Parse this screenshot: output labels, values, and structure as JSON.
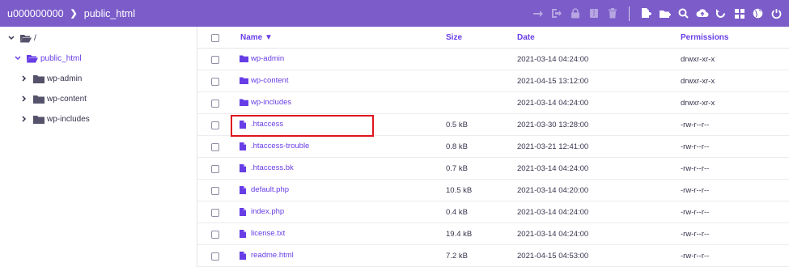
{
  "header": {
    "user": "u000000000",
    "folder": "public_html",
    "toolbar_icons": [
      "move-icon",
      "move-to-icon",
      "lock-icon",
      "archive-icon",
      "trash-icon",
      "new-file-icon",
      "new-folder-icon",
      "search-icon",
      "upload-icon",
      "refresh-icon",
      "grid-view-icon",
      "globe-icon",
      "power-icon"
    ]
  },
  "sidebar": {
    "root": "/",
    "current": "public_html",
    "children": [
      "wp-admin",
      "wp-content",
      "wp-includes"
    ]
  },
  "table": {
    "columns": {
      "name": "Name ▼",
      "size": "Size",
      "date": "Date",
      "permissions": "Permissions"
    },
    "rows": [
      {
        "name": "wp-admin",
        "type": "folder",
        "size": "",
        "date": "2021-03-14 04:24:00",
        "permissions": "drwxr-xr-x"
      },
      {
        "name": "wp-content",
        "type": "folder",
        "size": "",
        "date": "2021-04-15 13:12:00",
        "permissions": "drwxr-xr-x"
      },
      {
        "name": "wp-includes",
        "type": "folder",
        "size": "",
        "date": "2021-03-14 04:24:00",
        "permissions": "drwxr-xr-x"
      },
      {
        "name": ".htaccess",
        "type": "file",
        "size": "0.5 kB",
        "date": "2021-03-30 13:28:00",
        "permissions": "-rw-r--r--"
      },
      {
        "name": ".htaccess-trouble",
        "type": "file",
        "size": "0.8 kB",
        "date": "2021-03-21 12:41:00",
        "permissions": "-rw-r--r--"
      },
      {
        "name": ".htaccess.bk",
        "type": "file",
        "size": "0.7 kB",
        "date": "2021-03-14 04:24:00",
        "permissions": "-rw-r--r--"
      },
      {
        "name": "default.php",
        "type": "file",
        "size": "10.5 kB",
        "date": "2021-03-14 04:20:00",
        "permissions": "-rw-r--r--"
      },
      {
        "name": "index.php",
        "type": "file",
        "size": "0.4 kB",
        "date": "2021-03-14 04:24:00",
        "permissions": "-rw-r--r--"
      },
      {
        "name": "license.txt",
        "type": "file",
        "size": "19.4 kB",
        "date": "2021-03-14 04:24:00",
        "permissions": "-rw-r--r--"
      },
      {
        "name": "readme.html",
        "type": "file",
        "size": "7.2 kB",
        "date": "2021-04-15 04:53:00",
        "permissions": "-rw-r--r--"
      }
    ]
  },
  "colors": {
    "accent": "#673de6",
    "topbar": "#7b5cc9",
    "highlight": "#e0141e"
  }
}
